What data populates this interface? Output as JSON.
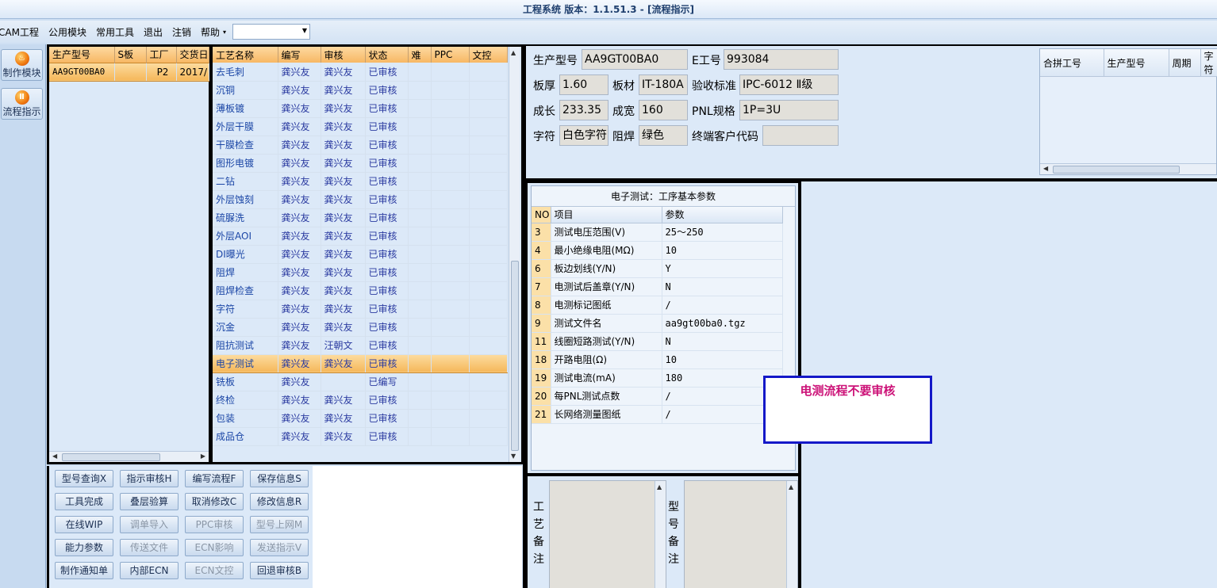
{
  "window": {
    "title": "工程系统  版本：1.1.51.3 - [流程指示]"
  },
  "menu": {
    "items": [
      "CAM工程",
      "公用模块",
      "常用工具",
      "退出",
      "注销",
      "帮助"
    ],
    "help_caret": "▾",
    "combo_value": ""
  },
  "sidebar": {
    "buttons": [
      {
        "label": "制作模块",
        "icon": "flame-icon"
      },
      {
        "label": "流程指示",
        "icon": "pause-icon"
      }
    ]
  },
  "model_list": {
    "columns": [
      "生产型号",
      "S板",
      "工厂",
      "交货日"
    ],
    "rows": [
      {
        "model": "AA9GT00BA0",
        "s": "",
        "factory": "P2",
        "date": "2017/"
      }
    ]
  },
  "process_table": {
    "columns": [
      "工艺名称",
      "编写",
      "审核",
      "状态",
      "难",
      "PPC",
      "文控"
    ],
    "rows": [
      [
        "去毛刺",
        "龚兴友",
        "龚兴友",
        "已审核"
      ],
      [
        "沉铜",
        "龚兴友",
        "龚兴友",
        "已审核"
      ],
      [
        "薄板镀",
        "龚兴友",
        "龚兴友",
        "已审核"
      ],
      [
        "外层干膜",
        "龚兴友",
        "龚兴友",
        "已审核"
      ],
      [
        "干膜检查",
        "龚兴友",
        "龚兴友",
        "已审核"
      ],
      [
        "图形电镀",
        "龚兴友",
        "龚兴友",
        "已审核"
      ],
      [
        "二钻",
        "龚兴友",
        "龚兴友",
        "已审核"
      ],
      [
        "外层蚀刻",
        "龚兴友",
        "龚兴友",
        "已审核"
      ],
      [
        "硫脲洗",
        "龚兴友",
        "龚兴友",
        "已审核"
      ],
      [
        "外层AOI",
        "龚兴友",
        "龚兴友",
        "已审核"
      ],
      [
        "DI曝光",
        "龚兴友",
        "龚兴友",
        "已审核"
      ],
      [
        "阻焊",
        "龚兴友",
        "龚兴友",
        "已审核"
      ],
      [
        "阻焊检查",
        "龚兴友",
        "龚兴友",
        "已审核"
      ],
      [
        "字符",
        "龚兴友",
        "龚兴友",
        "已审核"
      ],
      [
        "沉金",
        "龚兴友",
        "龚兴友",
        "已审核"
      ],
      [
        "阻抗测试",
        "龚兴友",
        "汪朝文",
        "已审核"
      ],
      [
        "电子测试",
        "龚兴友",
        "龚兴友",
        "已审核"
      ],
      [
        "铣板",
        "龚兴友",
        "",
        "已编写"
      ],
      [
        "终检",
        "龚兴友",
        "龚兴友",
        "已审核"
      ],
      [
        "包装",
        "龚兴友",
        "龚兴友",
        "已审核"
      ],
      [
        "成品仓",
        "龚兴友",
        "龚兴友",
        "已审核"
      ]
    ],
    "selected_index": 16
  },
  "actions": [
    [
      "型号查询X",
      "指示审核H",
      "编写流程F",
      "保存信息S"
    ],
    [
      "工具完成",
      "叠层验算",
      "取消修改C",
      "修改信息R"
    ],
    [
      "在线WIP",
      "调单导入",
      "PPC审核",
      "型号上网M"
    ],
    [
      "能力参数",
      "传送文件",
      "ECN影响",
      "发送指示V"
    ],
    [
      "制作通知单",
      "内部ECN",
      "ECN文控",
      "回退审核B"
    ]
  ],
  "actions_disabled": [
    "调单导入",
    "PPC审核",
    "型号上网M",
    "传送文件",
    "ECN影响",
    "发送指示V",
    "ECN文控"
  ],
  "info": {
    "model_label": "生产型号",
    "model": "AA9GT00BA0",
    "eno_label": "E工号",
    "eno": "993084",
    "thick_label": "板厚",
    "thick": "1.60",
    "material_label": "板材",
    "material": "IT-180A",
    "std_label": "验收标准",
    "std": "IPC-6012 Ⅱ级",
    "len_label": "成长",
    "len": "233.35",
    "wid_label": "成宽",
    "wid": "160",
    "pnl_label": "PNL规格",
    "pnl": "1P=3U",
    "char_label": "字符",
    "char": "白色字符",
    "mask_label": "阻焊",
    "mask": "绿色",
    "cust_label": "终端客户代码",
    "cust": ""
  },
  "combined": {
    "columns": [
      "合拼工号",
      "生产型号",
      "周期",
      "字符"
    ]
  },
  "params": {
    "title": "电子测试：工序基本参数",
    "columns": [
      "NO",
      "项目",
      "参数"
    ],
    "rows": [
      [
        "3",
        "测试电压范围(V)",
        "25～250"
      ],
      [
        "4",
        "最小绝缘电阻(MΩ)",
        "10"
      ],
      [
        "6",
        "板边划线(Y/N)",
        "Y"
      ],
      [
        "7",
        "电测试后盖章(Y/N)",
        "N"
      ],
      [
        "8",
        "电测标记图纸",
        "/"
      ],
      [
        "9",
        "测试文件名",
        "aa9gt00ba0.tgz"
      ],
      [
        "11",
        "线圈短路测试(Y/N)",
        "N"
      ],
      [
        "18",
        "开路电阻(Ω)",
        "10"
      ],
      [
        "19",
        "测试电流(mA)",
        "180"
      ],
      [
        "20",
        "每PNL测试点数",
        "/"
      ],
      [
        "21",
        "长网络测量图纸",
        "/"
      ]
    ]
  },
  "remarks": {
    "process_label": "工艺备注",
    "model_label": "型号备注"
  },
  "annotation": {
    "text": "电测流程不要审核"
  }
}
